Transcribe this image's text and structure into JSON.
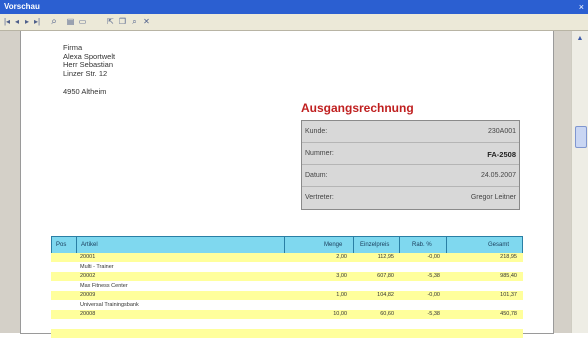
{
  "window": {
    "title": "Vorschau",
    "close_glyph": "×"
  },
  "toolbar": {
    "buttons": [
      {
        "icon": "first-page-icon",
        "glyph": "|◂"
      },
      {
        "icon": "prev-page-icon",
        "glyph": "◂"
      },
      {
        "icon": "next-page-icon",
        "glyph": "▸"
      },
      {
        "icon": "last-page-icon",
        "glyph": "▸|"
      },
      {
        "icon": "zoom-icon",
        "glyph": "⌕"
      },
      {
        "icon": "print-icon",
        "glyph": "▤"
      },
      {
        "icon": "page-setup-icon",
        "glyph": "▭"
      },
      {
        "icon": "export-icon",
        "glyph": "⇱"
      },
      {
        "icon": "copy-icon",
        "glyph": "❐"
      },
      {
        "icon": "find-icon",
        "glyph": "⌕"
      },
      {
        "icon": "close-preview-icon",
        "glyph": "✕"
      }
    ]
  },
  "address": {
    "lines": [
      "Firma",
      "Alexa Sportwelt",
      "Herr Sebastian",
      "Linzer Str. 12"
    ],
    "city": "4950 Altheim"
  },
  "document": {
    "title": "Ausgangsrechnung",
    "info": [
      {
        "label": "Kunde:",
        "value": "230A001"
      },
      {
        "label": "Nummer:",
        "value": "FA-2508"
      },
      {
        "label": "Datum:",
        "value": "24.05.2007"
      },
      {
        "label": "Vertreter:",
        "value": "Gregor Leitner"
      }
    ]
  },
  "table": {
    "headers": [
      "Pos",
      "Artikel",
      "Menge",
      "Einzelpreis",
      "Rab. %",
      "Gesamt"
    ],
    "rows": [
      {
        "art": "20001",
        "menge": "2,00",
        "ep": "112,95",
        "rab": "-0,00",
        "gesamt": "218,95"
      },
      {
        "art": "Multi - Trainer",
        "menge": "",
        "ep": "",
        "rab": "",
        "gesamt": ""
      },
      {
        "art": "20002",
        "menge": "3,00",
        "ep": "607,80",
        "rab": "-5,38",
        "gesamt": "985,40"
      },
      {
        "art": "Max Fitness Center",
        "menge": "",
        "ep": "",
        "rab": "",
        "gesamt": ""
      },
      {
        "art": "20009",
        "menge": "1,00",
        "ep": "104,82",
        "rab": "-0,00",
        "gesamt": "101,37"
      },
      {
        "art": "Universal Trainingsbank",
        "menge": "",
        "ep": "",
        "rab": "",
        "gesamt": ""
      },
      {
        "art": "20008",
        "menge": "10,00",
        "ep": "60,60",
        "rab": "-5,38",
        "gesamt": "450,78"
      }
    ]
  },
  "colors": {
    "title_bar": "#2b5fd1",
    "doc_title": "#c02020",
    "table_header": "#7fd8ef",
    "row_band": "#ffff9c"
  }
}
